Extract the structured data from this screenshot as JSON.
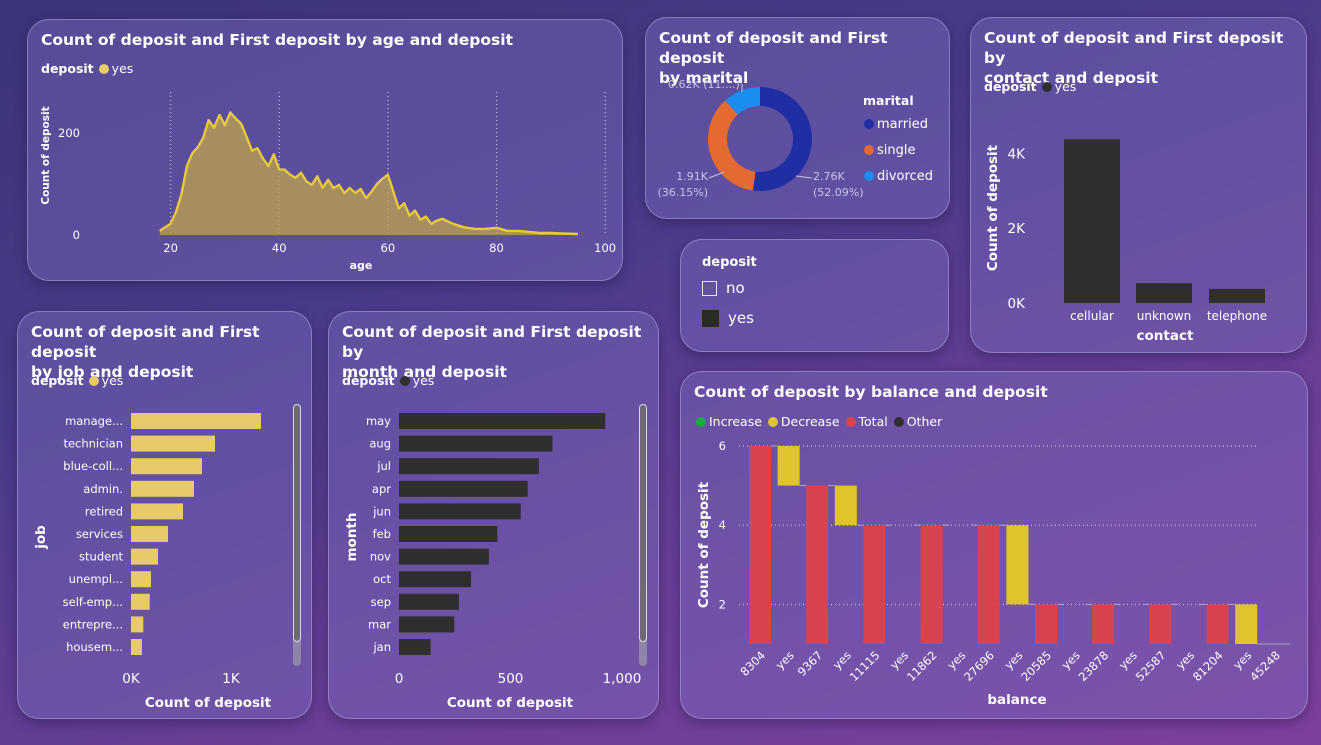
{
  "colors": {
    "gold": "#e6cb68",
    "dark": "#2f2f2f",
    "green": "#1aab40",
    "yellow": "#e0c42e",
    "red": "#d9434f",
    "married": "#1f2ea3",
    "single": "#e36a30",
    "divorced": "#1b8cf0"
  },
  "age_card": {
    "title": "Count of deposit and First deposit by age and deposit",
    "legend_title": "deposit",
    "legend_item": "yes"
  },
  "marital_card": {
    "title_line1": "Count of deposit and First deposit",
    "title_line2": "by marital",
    "legend_title": "marital"
  },
  "contact_card": {
    "title_line1": "Count of deposit and First deposit by",
    "title_line2": "contact and deposit",
    "legend_title": "deposit",
    "legend_item": "yes"
  },
  "slicer": {
    "title": "deposit",
    "options": [
      {
        "label": "no",
        "checked": false
      },
      {
        "label": "yes",
        "checked": true
      }
    ]
  },
  "job_card": {
    "title_line1": "Count of deposit and First deposit",
    "title_line2": "by job and deposit",
    "legend_title": "deposit",
    "legend_item": "yes"
  },
  "month_card": {
    "title_line1": "Count of deposit and First deposit by",
    "title_line2": "month and deposit",
    "legend_title": "deposit",
    "legend_item": "yes"
  },
  "balance_card": {
    "title": "Count of deposit by balance and deposit",
    "legend": [
      "Increase",
      "Decrease",
      "Total",
      "Other"
    ]
  },
  "chart_data": [
    {
      "type": "area",
      "id": "age",
      "xlabel": "age",
      "ylabel": "Count of deposit",
      "xlim": [
        14,
        102
      ],
      "ylim": [
        0,
        280
      ],
      "xticks": [
        20,
        40,
        60,
        80,
        100
      ],
      "yticks": [
        0,
        200
      ],
      "x": [
        18,
        19,
        20,
        21,
        22,
        23,
        24,
        25,
        26,
        27,
        28,
        29,
        30,
        31,
        32,
        33,
        34,
        35,
        36,
        37,
        38,
        39,
        40,
        41,
        42,
        43,
        44,
        45,
        46,
        47,
        48,
        49,
        50,
        51,
        52,
        53,
        54,
        55,
        56,
        57,
        58,
        59,
        60,
        61,
        62,
        63,
        64,
        65,
        66,
        67,
        68,
        69,
        70,
        72,
        74,
        76,
        78,
        80,
        82,
        84,
        86,
        88,
        90,
        92,
        95
      ],
      "y": [
        8,
        15,
        22,
        45,
        80,
        135,
        160,
        172,
        190,
        225,
        210,
        235,
        215,
        240,
        228,
        218,
        192,
        165,
        170,
        150,
        135,
        158,
        128,
        128,
        118,
        112,
        122,
        105,
        98,
        115,
        92,
        108,
        92,
        98,
        82,
        92,
        82,
        90,
        72,
        85,
        100,
        110,
        118,
        85,
        52,
        62,
        38,
        48,
        30,
        36,
        22,
        28,
        32,
        22,
        15,
        12,
        12,
        14,
        8,
        8,
        6,
        4,
        4,
        3,
        2
      ],
      "series_name": "yes"
    },
    {
      "type": "pie",
      "id": "marital",
      "variant": "donut",
      "slices": [
        {
          "name": "married",
          "value": 2.76,
          "label": "2.76K",
          "pct": "(52.09%)"
        },
        {
          "name": "single",
          "value": 1.91,
          "label": "1.91K",
          "pct": "(36.15%)"
        },
        {
          "name": "divorced",
          "value": 0.62,
          "label": "0.62K (11....)"
        }
      ]
    },
    {
      "type": "bar",
      "id": "contact",
      "xlabel": "contact",
      "ylabel": "Count of deposit",
      "categories": [
        "cellular",
        "unknown",
        "telephone"
      ],
      "values": [
        4380,
        530,
        380
      ],
      "ylim": [
        0,
        5000
      ],
      "yticks": [
        0,
        2000,
        4000
      ],
      "ytick_labels": [
        "0K",
        "2K",
        "4K"
      ],
      "series_name": "yes"
    },
    {
      "type": "bar",
      "id": "job",
      "orientation": "horizontal",
      "xlabel": "Count of deposit",
      "ylabel": "job",
      "categories": [
        "manage...",
        "technician",
        "blue-coll...",
        "admin.",
        "retired",
        "services",
        "student",
        "unempl...",
        "self-emp...",
        "entrepre...",
        "housem..."
      ],
      "values": [
        1300,
        840,
        710,
        630,
        520,
        370,
        270,
        200,
        187,
        123,
        109
      ],
      "xlim": [
        0,
        1400
      ],
      "xticks": [
        0,
        1000
      ],
      "xtick_labels": [
        "0K",
        "1K"
      ],
      "series_name": "yes"
    },
    {
      "type": "bar",
      "id": "month",
      "orientation": "horizontal",
      "xlabel": "Count of deposit",
      "ylabel": "month",
      "categories": [
        "may",
        "aug",
        "jul",
        "apr",
        "jun",
        "feb",
        "nov",
        "oct",
        "sep",
        "mar",
        "jan"
      ],
      "values": [
        925,
        688,
        627,
        577,
        546,
        441,
        403,
        323,
        269,
        248,
        142
      ],
      "xlim": [
        0,
        1000
      ],
      "xticks": [
        0,
        500,
        1000
      ],
      "xtick_labels": [
        "0",
        "500",
        "1,000"
      ],
      "series_name": "yes"
    },
    {
      "type": "bar",
      "id": "balance",
      "variant": "waterfall",
      "xlabel": "balance",
      "ylabel": "Count of deposit",
      "ylim": [
        1,
        6.1
      ],
      "yticks": [
        2,
        4,
        6
      ],
      "bars": [
        {
          "label": "8304",
          "kind": "Total",
          "from": 1,
          "to": 6
        },
        {
          "label": "yes",
          "kind": "Decrease",
          "from": 6,
          "to": 5
        },
        {
          "label": "9367",
          "kind": "Total",
          "from": 1,
          "to": 5
        },
        {
          "label": "yes",
          "kind": "Decrease",
          "from": 5,
          "to": 4
        },
        {
          "label": "11115",
          "kind": "Total",
          "from": 1,
          "to": 4
        },
        {
          "label": "yes",
          "kind": "Decrease",
          "from": 4,
          "to": 4
        },
        {
          "label": "11862",
          "kind": "Total",
          "from": 1,
          "to": 4
        },
        {
          "label": "yes",
          "kind": "Decrease",
          "from": 4,
          "to": 4
        },
        {
          "label": "27696",
          "kind": "Total",
          "from": 1,
          "to": 4
        },
        {
          "label": "yes",
          "kind": "Decrease",
          "from": 4,
          "to": 2
        },
        {
          "label": "20585",
          "kind": "Total",
          "from": 1,
          "to": 2
        },
        {
          "label": "yes",
          "kind": "Decrease",
          "from": 2,
          "to": 2
        },
        {
          "label": "23878",
          "kind": "Total",
          "from": 1,
          "to": 2
        },
        {
          "label": "yes",
          "kind": "Decrease",
          "from": 2,
          "to": 2
        },
        {
          "label": "52587",
          "kind": "Total",
          "from": 1,
          "to": 2
        },
        {
          "label": "yes",
          "kind": "Decrease",
          "from": 2,
          "to": 2
        },
        {
          "label": "81204",
          "kind": "Total",
          "from": 1,
          "to": 2
        },
        {
          "label": "yes",
          "kind": "Decrease",
          "from": 2,
          "to": 1
        },
        {
          "label": "45248",
          "kind": "Total",
          "from": 1,
          "to": 1
        }
      ]
    }
  ]
}
